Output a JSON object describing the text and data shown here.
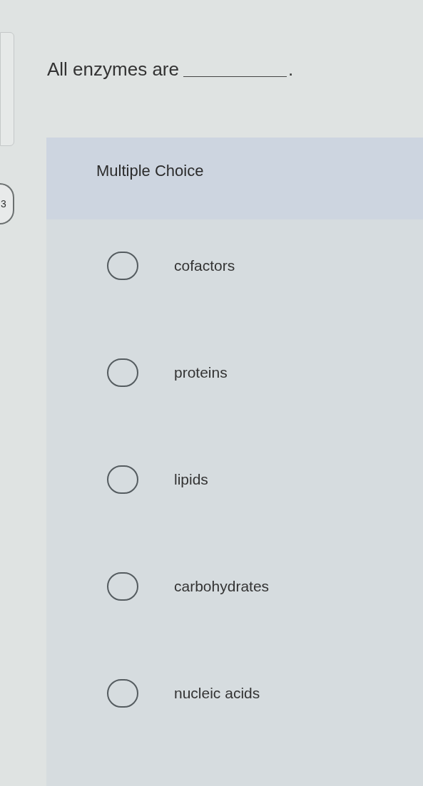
{
  "question_number": "3",
  "question": {
    "text": "All enzymes are",
    "end": "."
  },
  "section_title": "Multiple Choice",
  "options": [
    {
      "label": "cofactors",
      "selected": false
    },
    {
      "label": "proteins",
      "selected": false
    },
    {
      "label": "lipids",
      "selected": false
    },
    {
      "label": "carbohydrates",
      "selected": false
    },
    {
      "label": "nucleic acids",
      "selected": false
    }
  ]
}
